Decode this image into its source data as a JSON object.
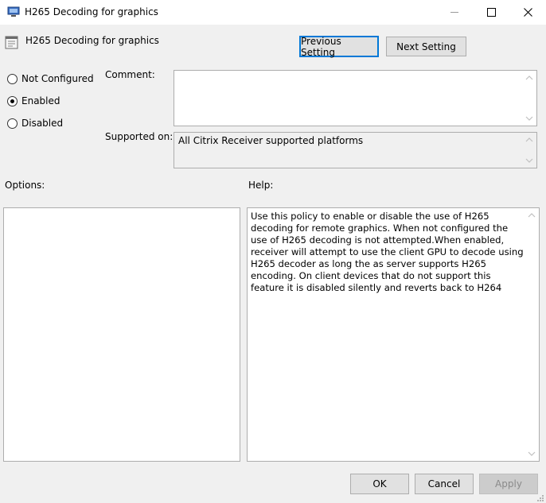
{
  "window": {
    "title": "H265 Decoding for graphics"
  },
  "header": {
    "policy_name": "H265 Decoding for graphics",
    "previous_label": "Previous Setting",
    "next_label": "Next Setting"
  },
  "state": {
    "options": [
      "Not Configured",
      "Enabled",
      "Disabled"
    ],
    "selected": "Enabled"
  },
  "comment": {
    "label": "Comment:",
    "value": ""
  },
  "supported": {
    "label": "Supported on:",
    "value": "All Citrix Receiver supported platforms"
  },
  "options_section": {
    "label": "Options:"
  },
  "help_section": {
    "label": "Help:",
    "text": "Use this policy to enable or disable the use of H265 decoding for remote graphics. When not configured the use of H265 decoding is not attempted.When enabled, receiver will attempt to use the client GPU to decode using H265 decoder as long the as server supports H265 encoding. On client devices that do not support this feature it is disabled silently and reverts back to H264"
  },
  "footer": {
    "ok_label": "OK",
    "cancel_label": "Cancel",
    "apply_label": "Apply",
    "apply_enabled": false
  },
  "icons": [
    "app-icon",
    "policy-setting-icon",
    "minimize-icon",
    "maximize-icon",
    "close-icon",
    "scroll-up-icon",
    "scroll-down-icon",
    "resize-grip-icon"
  ]
}
